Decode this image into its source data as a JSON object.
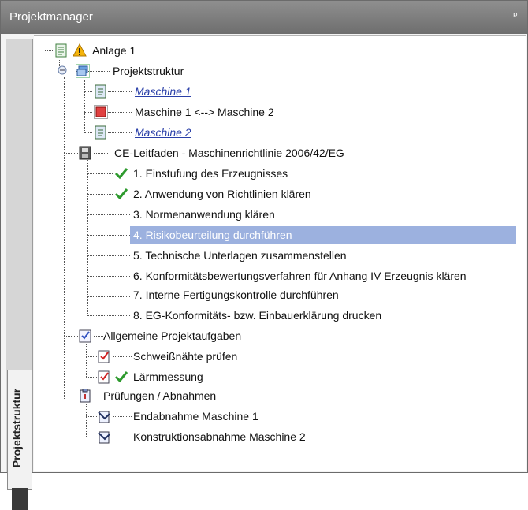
{
  "panel": {
    "title": "Projektmanager",
    "pin_glyph": "ᵖ"
  },
  "side_tab": {
    "label": "Projektstruktur"
  },
  "tree": {
    "root": {
      "label": "Anlage 1",
      "icon": "document-icon",
      "warning_icon": "warning-icon"
    },
    "projektstruktur": {
      "label": "Projektstruktur",
      "icon": "structure-icon"
    },
    "maschine1": {
      "label": "Maschine 1",
      "icon": "machine-icon"
    },
    "interface": {
      "label": "Maschine 1 <--> Maschine 2",
      "icon": "interface-icon"
    },
    "maschine2": {
      "label": "Maschine 2",
      "icon": "machine-icon"
    },
    "ce": {
      "label": "CE-Leitfaden - Maschinenrichtlinie 2006/42/EG",
      "icon": "guide-icon"
    },
    "steps": [
      {
        "label": "1. Einstufung des Erzeugnisses",
        "done": true
      },
      {
        "label": "2. Anwendung von Richtlinien klären",
        "done": true
      },
      {
        "label": "3. Normenanwendung klären",
        "done": false
      },
      {
        "label": "4. Risikobeurteilung durchführen",
        "done": false,
        "selected": true
      },
      {
        "label": "5. Technische Unterlagen zusammenstellen",
        "done": false
      },
      {
        "label": "6. Konformitätsbewertungsverfahren für Anhang IV Erzeugnis klären",
        "done": false
      },
      {
        "label": "7. Interne Fertigungskontrolle durchführen",
        "done": false
      },
      {
        "label": "8. EG-Konformitäts- bzw. Einbauerklärung drucken",
        "done": false
      }
    ],
    "tasks": {
      "label": "Allgemeine Projektaufgaben",
      "icon": "task-list-icon"
    },
    "task_items": [
      {
        "label": "Schweißnähte prüfen",
        "done": false
      },
      {
        "label": "Lärmmessung",
        "done": true
      }
    ],
    "checks": {
      "label": "Prüfungen / Abnahmen",
      "icon": "inspection-icon"
    },
    "check_items": [
      {
        "label": "Endabnahme Maschine 1"
      },
      {
        "label": "Konstruktionsabnahme Maschine 2"
      }
    ]
  },
  "colors": {
    "selection": "#9cb1df",
    "link": "#2a3fa8",
    "check": "#2e9a2e",
    "titlebar": "#7d7d7d"
  }
}
